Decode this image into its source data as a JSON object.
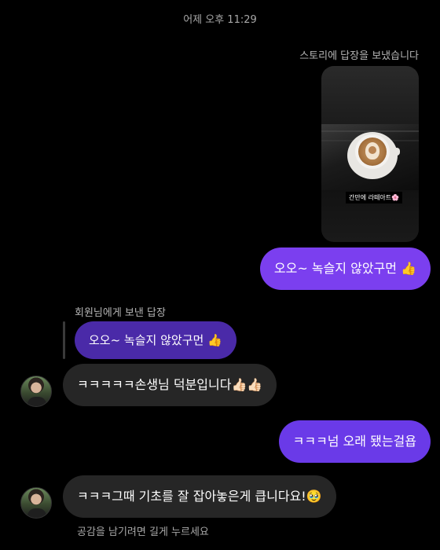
{
  "header": {
    "timestamp": "어제 오후 11:29"
  },
  "story_reply": {
    "label": "스토리에 답장을 보냈습니다",
    "story_caption": "간만에 라떼아트🌸"
  },
  "messages": [
    {
      "id": "m1",
      "direction": "sent",
      "text": "오오~ 녹슬지 않았구먼 👍"
    },
    {
      "id": "m2",
      "direction": "received",
      "reply_to_label": "회원님에게 보낸 답장",
      "reply_to_text": "오오~ 녹슬지 않았구먼 👍",
      "text": "ㅋㅋㅋㅋㅋ손생님 덕분입니다👍🏻👍🏻"
    },
    {
      "id": "m3",
      "direction": "sent",
      "text": "ㅋㅋㅋ넘 오래 됐는걸욥"
    },
    {
      "id": "m4",
      "direction": "received",
      "text": "ㅋㅋㅋ그때 기초를 잘 잡아놓은게 큽니다요!🥹"
    }
  ],
  "footer": {
    "hint": "공감을 남기려면 길게 누르세요"
  },
  "colors": {
    "sent_bubble": "#7b3fef",
    "received_bubble": "#262626",
    "quoted_reply_bubble": "#4a2aa8",
    "background": "#000000"
  },
  "icons": {
    "avatar": "profile-photo"
  }
}
